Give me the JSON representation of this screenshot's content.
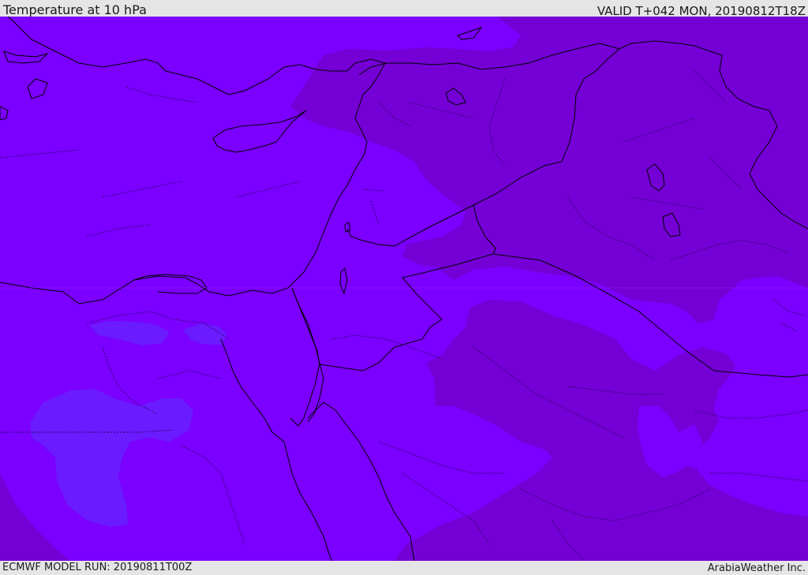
{
  "header": {
    "title": "Temperature at 10 hPa",
    "valid": "VALID T+042 MON, 20190812T18Z"
  },
  "footer": {
    "model_run": "ECMWF MODEL RUN: 20190811T00Z",
    "brand": "ArabiaWeather Inc."
  },
  "map": {
    "colors": {
      "background": "#7b00ff",
      "warmer_zone": "#7400d6",
      "cooler_zone": "#6a1bff",
      "coastline": "#000000",
      "borders": "#2a0060"
    }
  }
}
